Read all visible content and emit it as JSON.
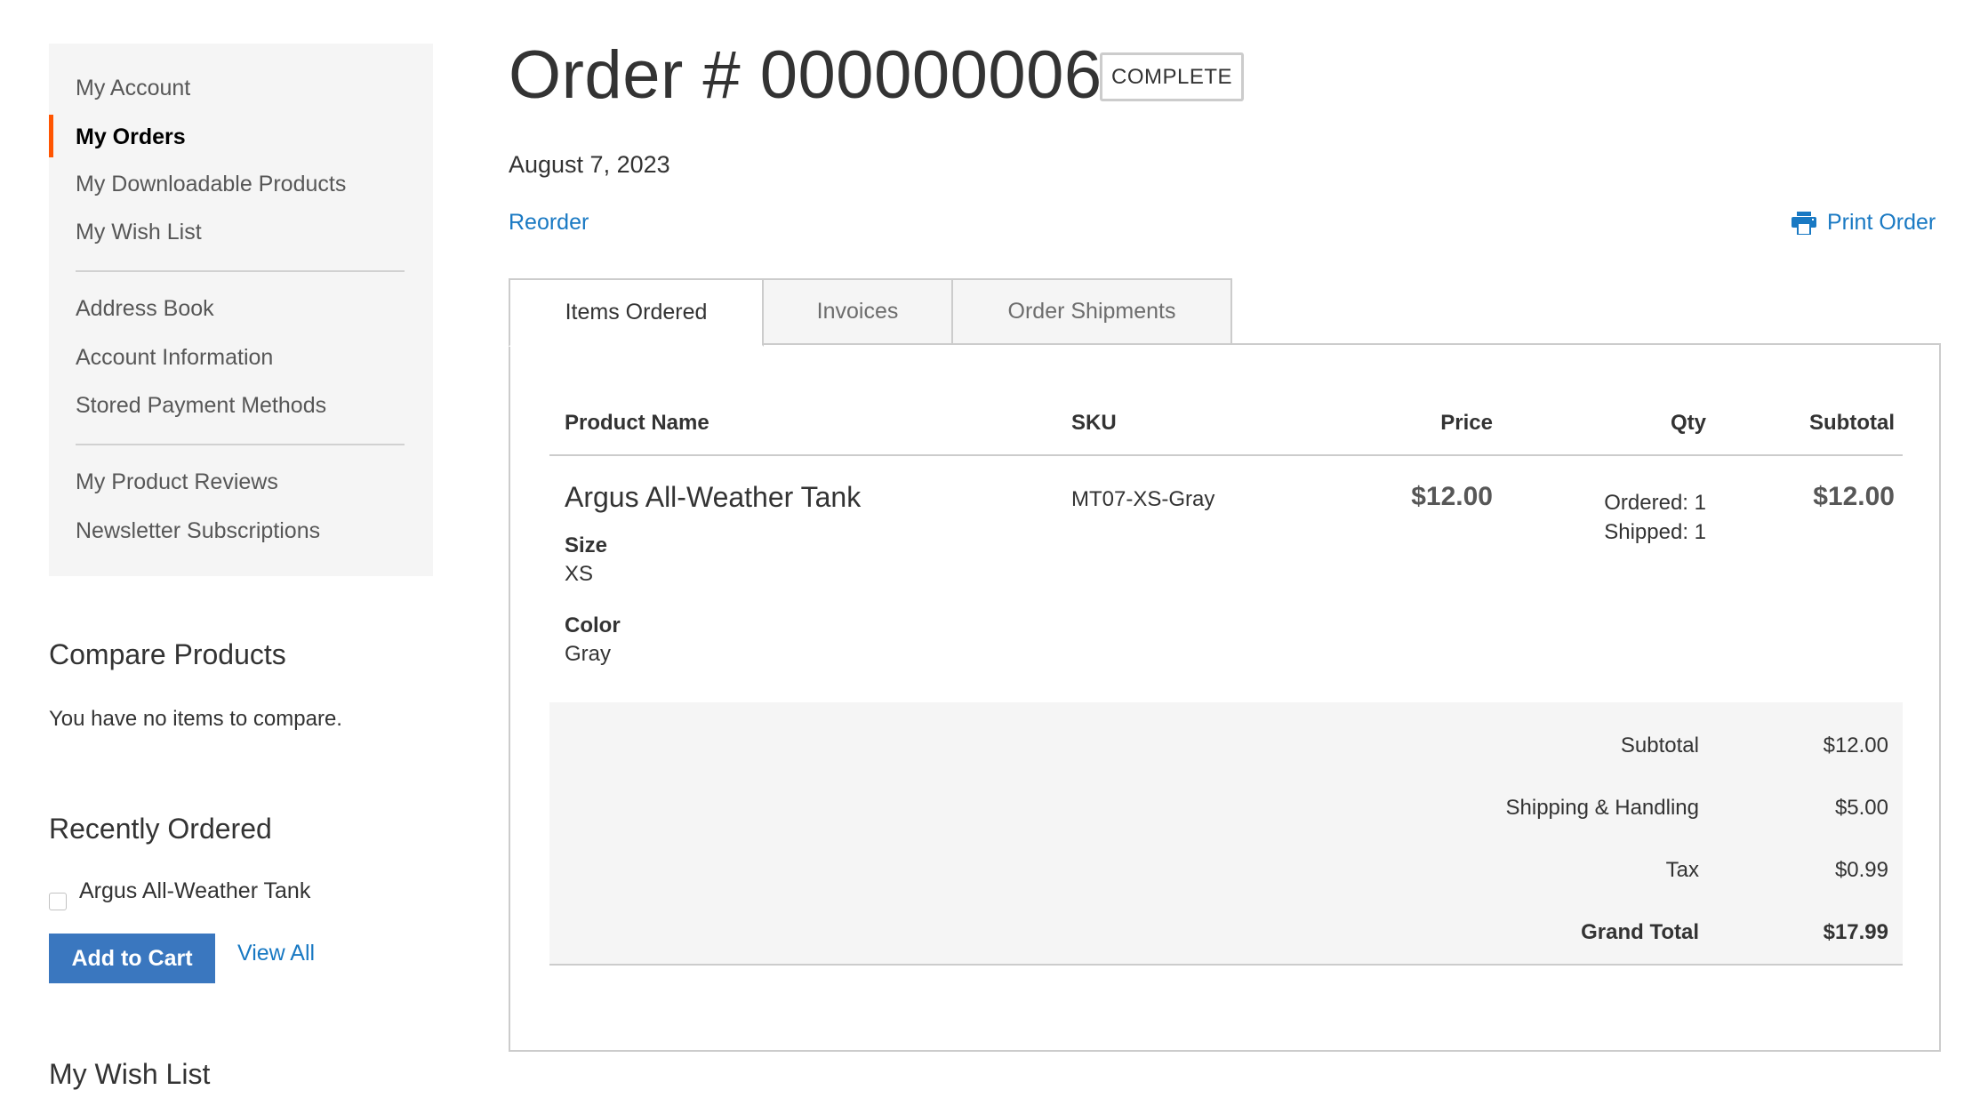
{
  "sidebar": {
    "nav": {
      "items": [
        {
          "label": "My Account",
          "active": false
        },
        {
          "label": "My Orders",
          "active": true
        },
        {
          "label": "My Downloadable Products",
          "active": false
        },
        {
          "label": "My Wish List",
          "active": false
        },
        {
          "label": "Address Book",
          "active": false
        },
        {
          "label": "Account Information",
          "active": false
        },
        {
          "label": "Stored Payment Methods",
          "active": false
        },
        {
          "label": "My Product Reviews",
          "active": false
        },
        {
          "label": "Newsletter Subscriptions",
          "active": false
        }
      ],
      "active_color": "#ff5501"
    },
    "compare": {
      "title": "Compare Products",
      "empty_text": "You have no items to compare."
    },
    "recently_ordered": {
      "title": "Recently Ordered",
      "items": [
        {
          "name": "Argus All-Weather Tank",
          "checked": false
        }
      ],
      "add_to_cart_label": "Add to Cart",
      "view_all_label": "View All"
    },
    "wishlist": {
      "title": "My Wish List"
    }
  },
  "order": {
    "title": "Order # 000000006",
    "status": "COMPLETE",
    "date": "August 7, 2023",
    "reorder_label": "Reorder",
    "print_label": "Print Order",
    "print_icon": "printer-icon"
  },
  "tabs": [
    {
      "label": "Items Ordered",
      "active": true
    },
    {
      "label": "Invoices",
      "active": false
    },
    {
      "label": "Order Shipments",
      "active": false
    }
  ],
  "items_table": {
    "columns": [
      "Product Name",
      "SKU",
      "Price",
      "Qty",
      "Subtotal"
    ],
    "rows": [
      {
        "product_name": "Argus All-Weather Tank",
        "options": [
          {
            "label": "Size",
            "value": "XS"
          },
          {
            "label": "Color",
            "value": "Gray"
          }
        ],
        "sku": "MT07-XS-Gray",
        "price": "$12.00",
        "qty_ordered": "Ordered: 1",
        "qty_shipped": "Shipped: 1",
        "subtotal": "$12.00"
      }
    ]
  },
  "totals": [
    {
      "label": "Subtotal",
      "value": "$12.00",
      "bold": false
    },
    {
      "label": "Shipping & Handling",
      "value": "$5.00",
      "bold": false
    },
    {
      "label": "Tax",
      "value": "$0.99",
      "bold": false
    },
    {
      "label": "Grand Total",
      "value": "$17.99",
      "bold": true
    }
  ],
  "colors": {
    "link": "#1979c3",
    "button": "#3a77bf",
    "nav_active_bar": "#ff5501",
    "panel_bg": "#f5f5f5"
  }
}
